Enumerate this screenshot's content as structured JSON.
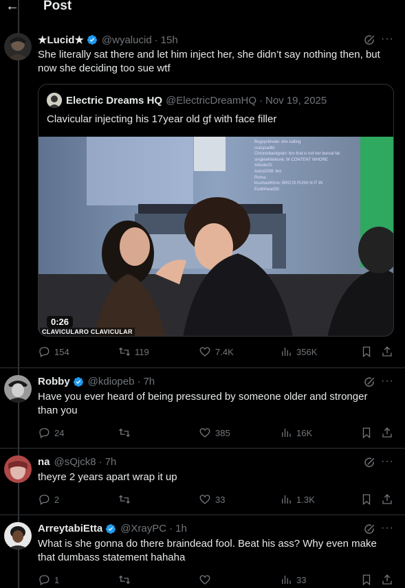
{
  "header": {
    "back_icon": "arrow-left-icon",
    "title": "Post"
  },
  "colors": {
    "background": "#000000",
    "text": "#e7e9ea",
    "muted": "#71767b",
    "verified": "#1d9bf0",
    "border": "#2f3336"
  },
  "tweets": [
    {
      "name": "★Lucid★",
      "handle": "@wyalucid",
      "time": "15h",
      "verified": true,
      "text": "She literally sat there and let him inject her, she didn’t say nothing then, but now she deciding too sue wtf",
      "quote": {
        "name": "Electric Dreams HQ",
        "handle": "@ElectricDreamHQ",
        "time": "Nov 19, 2025",
        "text": "Clavicular injecting his 17year old gf with face filler",
        "video_duration": "0:26",
        "watermark": "CLAVICULARO CLAVICULAR"
      },
      "replies": "154",
      "reposts": "119",
      "likes": "7.4K",
      "views": "356K"
    },
    {
      "name": "Robby",
      "handle": "@kdiopeb",
      "time": "7h",
      "verified": true,
      "text": "Have you ever heard of being pressured by someone older and stronger than you",
      "replies": "24",
      "reposts": "",
      "likes": "385",
      "views": "16K"
    },
    {
      "name": "na",
      "handle": "@sQjck8",
      "time": "7h",
      "verified": false,
      "text": "theyre 2 years apart wrap it up",
      "replies": "2",
      "reposts": "",
      "likes": "33",
      "views": "1.3K"
    },
    {
      "name": "ArreytabiEtta",
      "handle": "@XrayPC",
      "time": "1h",
      "verified": true,
      "text": "What is she gonna do there braindead fool. Beat his ass? Why even make that dumbass statement hahaha",
      "replies": "1",
      "reposts": "",
      "likes": "",
      "views": "33"
    }
  ],
  "chat_lines": [
    "Bogsyclimate: she calling",
    "crazycarlbt: ",
    "Chronicbackgrain: bro that is not her buccal fat",
    "singlewhitehunk: W CONTENT WHORE",
    "Aiitude23: ",
    "Astro2008: bro",
    "Roma: ",
    "krushoutKhris: BRO IS PUSH N IT IN",
    "Eudinhead33: "
  ]
}
